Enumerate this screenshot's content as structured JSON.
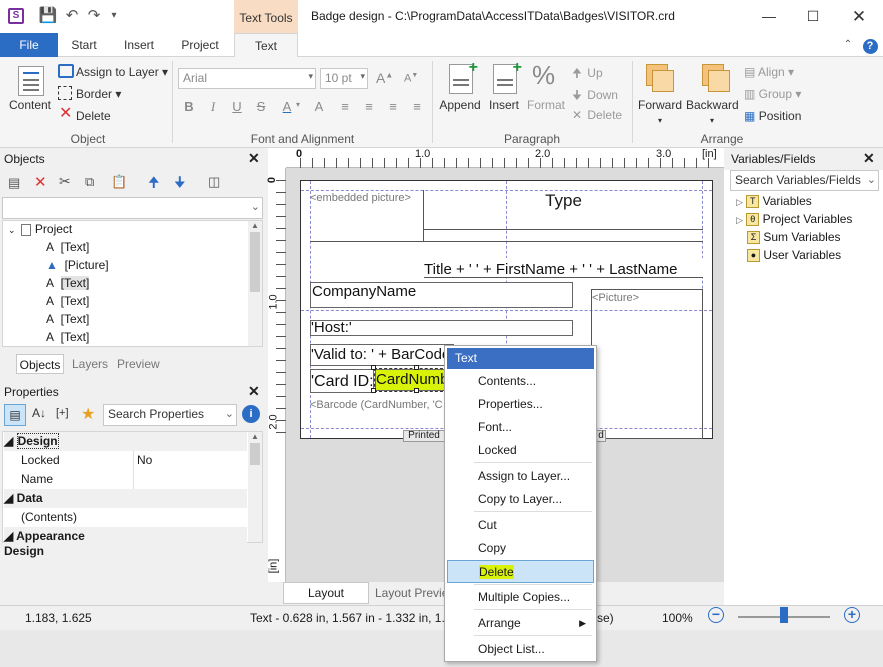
{
  "window": {
    "title": "Badge design - C:\\ProgramData\\AccessITData\\Badges\\VISITOR.crd",
    "contextual_tab_group": "Text Tools"
  },
  "tabs": [
    "File",
    "Start",
    "Insert",
    "Project",
    "Text"
  ],
  "ribbon": {
    "object_group": {
      "label": "Object",
      "content": "Content",
      "assign_to_layer": "Assign to Layer",
      "border": "Border",
      "delete": "Delete"
    },
    "font_group": {
      "label": "Font and Alignment",
      "font_name": "Arial",
      "font_size": "10 pt"
    },
    "paragraph_group": {
      "label": "Paragraph",
      "append": "Append",
      "insert": "Insert",
      "format": "Format",
      "up": "Up",
      "down": "Down",
      "delete": "Delete"
    },
    "arrange_group": {
      "label": "Arrange",
      "forward": "Forward",
      "backward": "Backward",
      "align": "Align",
      "group": "Group",
      "position": "Position"
    }
  },
  "objects_pane": {
    "title": "Objects",
    "tree": [
      "Project",
      "[Text]",
      "[Picture]",
      "[Text]",
      "[Text]",
      "[Text]",
      "[Text]"
    ],
    "tabs": [
      "Objects",
      "Layers",
      "Preview"
    ]
  },
  "properties_pane": {
    "title": "Properties",
    "search_placeholder": "Search Properties",
    "rows": [
      {
        "name": "Design",
        "value": "",
        "category": true
      },
      {
        "name": "Locked",
        "value": "No",
        "category": false
      },
      {
        "name": "Name",
        "value": "",
        "category": false
      },
      {
        "name": "Data",
        "value": "",
        "category": true
      },
      {
        "name": "(Contents)",
        "value": "",
        "category": false
      },
      {
        "name": "Appearance",
        "value": "",
        "category": true
      }
    ],
    "description_title": "Design"
  },
  "canvas": {
    "ruler_h_labels": [
      "0",
      "1.0",
      "2.0",
      "3.0"
    ],
    "ruler_unit": "[in]",
    "ruler_v_labels": [
      "0",
      "1.0",
      "2.0"
    ],
    "fields": {
      "embedded_picture": "<embedded picture>",
      "type": "Type",
      "title_line": "Title + ' ' + FirstName + ' ' + LastName",
      "company": "CompanyName",
      "picture": "<Picture>",
      "host": "'Host:'",
      "valid_to": "'Valid to: ' + BarCode",
      "card_id_label": "'Card ID:'",
      "card_number": "CardNumber",
      "barcode": "<Barcode (CardNumber, 'C",
      "printed": "Printed",
      "printed_end": "d"
    },
    "bottom_tabs": [
      "Layout",
      "Layout Preview"
    ]
  },
  "context_menu": {
    "header": "Text",
    "items": [
      "Contents...",
      "Properties...",
      "Font...",
      "Locked",
      "Assign to Layer...",
      "Copy to Layer...",
      "Cut",
      "Copy",
      "Delete",
      "Multiple Copies...",
      "Arrange",
      "Object List..."
    ],
    "highlighted": "Delete",
    "highlight_color": "#d8f20a"
  },
  "variables_pane": {
    "title": "Variables/Fields",
    "search_placeholder": "Search Variables/Fields",
    "items": [
      "Variables",
      "Project Variables",
      "Sum Variables",
      "User Variables"
    ]
  },
  "statusbar": {
    "cursor": "1.183, 1.625",
    "object_info": "Text  -  0.628 in, 1.567 in  -  1.332 in, 1.",
    "object_info_tail": "se)",
    "zoom": "100%",
    "zoom_level_percent": 50
  }
}
